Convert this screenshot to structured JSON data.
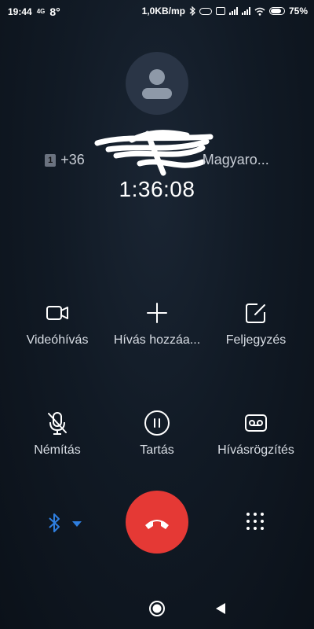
{
  "status_bar": {
    "time": "19:44",
    "network_small_1": "4G",
    "temperature": "8°",
    "speed": "1,0KB/mp",
    "battery": "75%"
  },
  "call": {
    "sim": "1",
    "number_prefix": "+36",
    "location": "Magyaro...",
    "duration": "1:36:08"
  },
  "actions": {
    "video": "Videóhívás",
    "add_call": "Hívás hozzáa...",
    "notes": "Feljegyzés",
    "mute": "Némítás",
    "hold": "Tartás",
    "record": "Hívásrögzítés"
  },
  "colors": {
    "end_call": "#e53935",
    "bluetooth": "#2f7fe0"
  }
}
